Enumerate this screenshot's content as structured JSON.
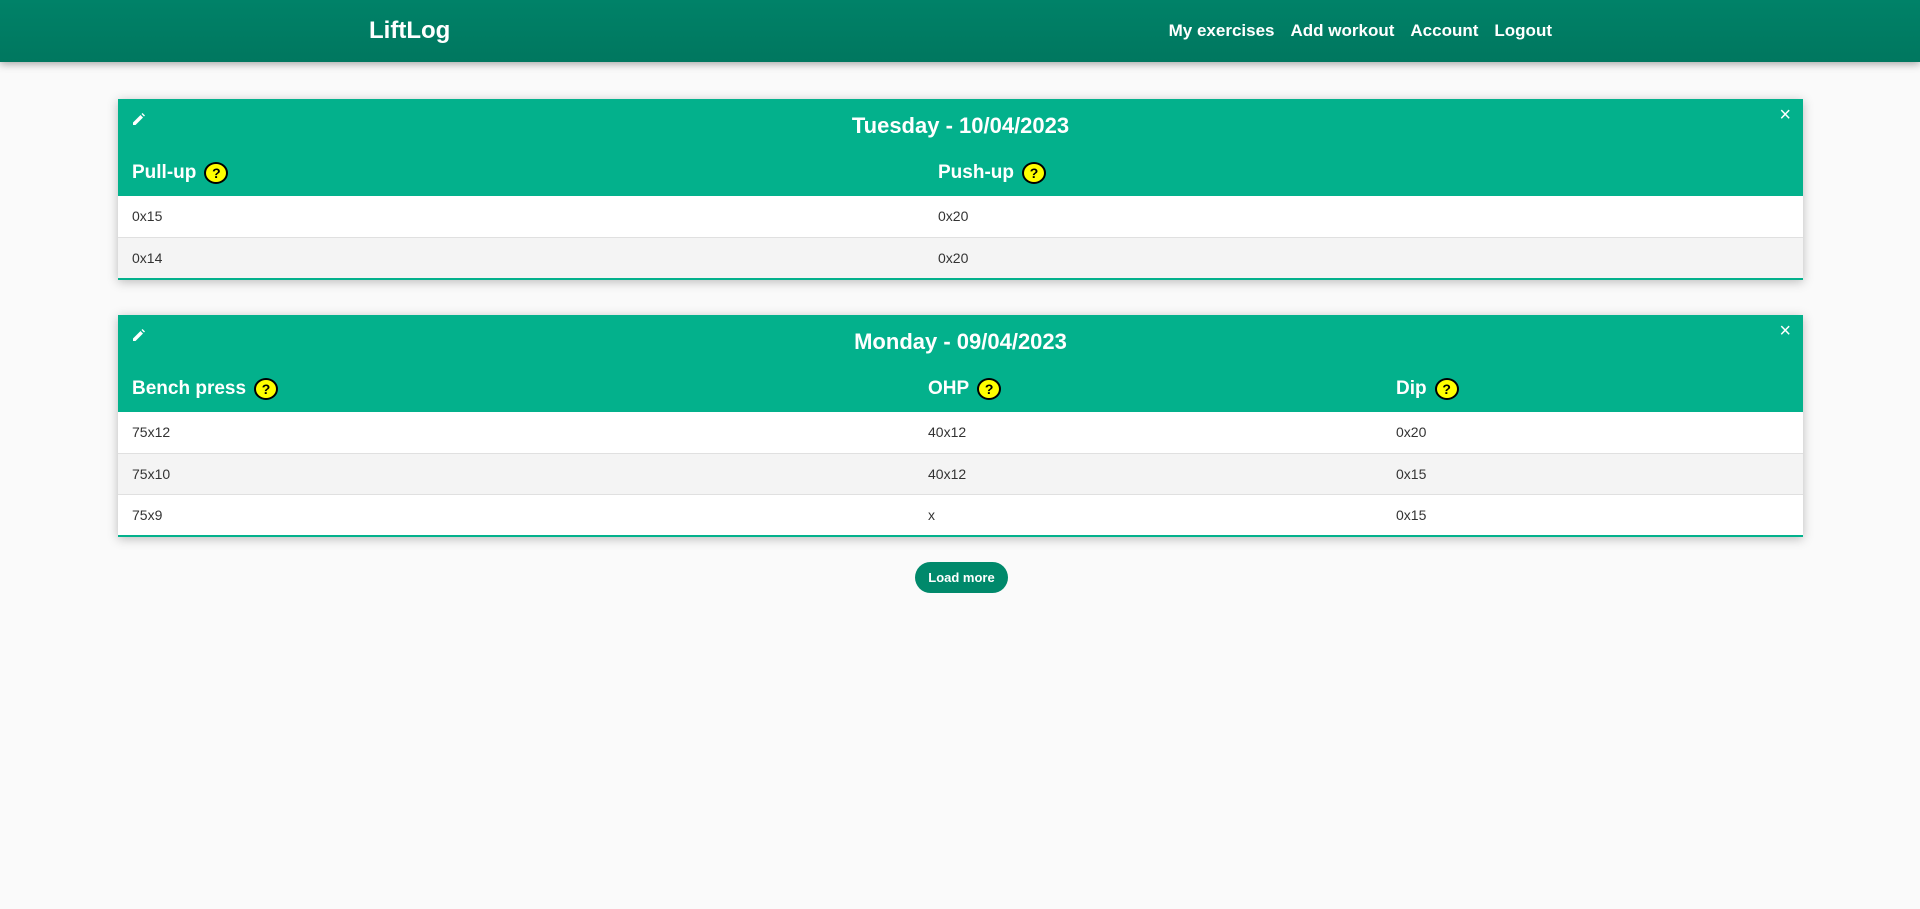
{
  "nav": {
    "brand": "LiftLog",
    "links": [
      "My exercises",
      "Add workout",
      "Account",
      "Logout"
    ]
  },
  "workouts": [
    {
      "title": "Tuesday - 10/04/2023",
      "exercises": [
        "Pull-up",
        "Push-up"
      ],
      "sets": [
        [
          "0x15",
          "0x20"
        ],
        [
          "0x14",
          "0x20"
        ]
      ]
    },
    {
      "title": "Monday - 09/04/2023",
      "exercises": [
        "Bench press",
        "OHP",
        "Dip"
      ],
      "sets": [
        [
          "75x12",
          "40x12",
          "0x20"
        ],
        [
          "75x10",
          "40x12",
          "0x15"
        ],
        [
          "75x9",
          "x",
          "0x15"
        ]
      ]
    }
  ],
  "help_label": "?",
  "close_label": "×",
  "load_more_label": "Load more",
  "colors": {
    "navbar": "#007f66",
    "card_header": "#03b18c",
    "help_badge": "#ffff00",
    "button": "#00896b"
  }
}
